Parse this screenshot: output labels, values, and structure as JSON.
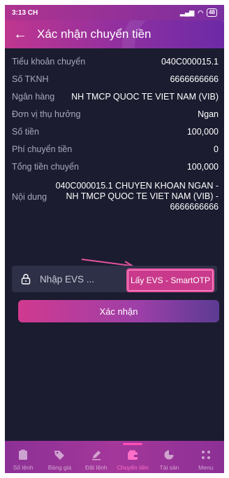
{
  "status_bar": {
    "time": "3:13 CH",
    "battery": "48"
  },
  "header": {
    "title": "Xác nhận chuyển tiền"
  },
  "details": [
    {
      "label": "Tiểu khoản chuyển",
      "value": "040C000015.1"
    },
    {
      "label": "Số TKNH",
      "value": "6666666666"
    },
    {
      "label": "Ngân hàng",
      "value": "NH TMCP QUOC TE VIET NAM (VIB)"
    },
    {
      "label": "Đơn vị thụ hưởng",
      "value": "Ngan"
    },
    {
      "label": "Số tiền",
      "value": "100,000"
    },
    {
      "label": "Phí chuyển tiền",
      "value": "0"
    },
    {
      "label": "Tổng tiền chuyển",
      "value": "100,000"
    }
  ],
  "content": {
    "label": "Nội dung",
    "value": "040C000015.1 CHUYEN KHOAN NGAN - NH TMCP QUOC TE VIET NAM (VIB) - 6666666666"
  },
  "evs": {
    "placeholder": "Nhập EVS ...",
    "otp_button": "Lấy EVS - SmartOTP"
  },
  "confirm_button": "Xác nhận",
  "nav": [
    {
      "label": "Sổ lệnh",
      "icon": "clipboard-icon",
      "active": false
    },
    {
      "label": "Bảng giá",
      "icon": "tag-icon",
      "active": false
    },
    {
      "label": "Đặt lệnh",
      "icon": "pen-icon",
      "active": false
    },
    {
      "label": "Chuyển tiền",
      "icon": "wallet-icon",
      "active": true
    },
    {
      "label": "Tài sản",
      "icon": "pie-chart-icon",
      "active": false
    },
    {
      "label": "Menu",
      "icon": "grid-icon",
      "active": false
    }
  ],
  "colors": {
    "accent": "#c93a8c",
    "background": "#1b1c2f",
    "arrow": "#e4539f"
  }
}
